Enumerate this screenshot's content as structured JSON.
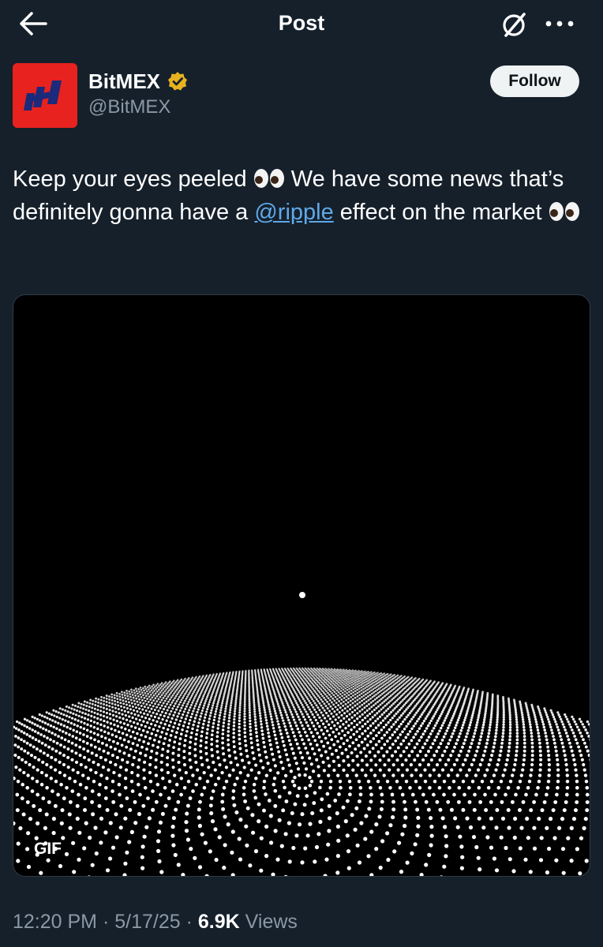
{
  "header": {
    "title": "Post",
    "back_icon": "arrow-left-icon",
    "grok_icon": "grok-slash-circle-icon",
    "more_icon": "more-horizontal-icon"
  },
  "author": {
    "display_name": "BitMEX",
    "handle": "@BitMEX",
    "verified_icon": "gold-verified-badge-icon",
    "verified_color": "#e8b21f",
    "avatar_color": "#e8221f",
    "follow_label": "Follow"
  },
  "post": {
    "text_1": "Keep your eyes peeled",
    "text_2": "We have some news that’s definitely gonna have a",
    "mention": "@ripple",
    "text_3": "effect on the market",
    "emoji_icon": "eyes-emoji-icon",
    "media_badge": "GIF"
  },
  "meta": {
    "time": "12:20 PM",
    "sep1": "·",
    "date": "5/17/25",
    "sep2": "·",
    "views_count": "6.9K",
    "views_label": "Views"
  },
  "colors": {
    "background": "#15202b",
    "link": "#5fa8e8",
    "secondary_text": "#8b98a5"
  }
}
